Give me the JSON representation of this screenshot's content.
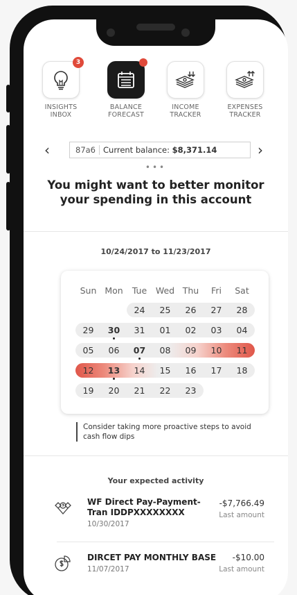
{
  "tabs": [
    {
      "label_line1": "INSIGHTS",
      "label_line2": "INBOX",
      "badge": "3",
      "icon": "lightbulb-icon",
      "active": false
    },
    {
      "label_line1": "BALANCE",
      "label_line2": "FORECAST",
      "badge": "",
      "icon": "calendar-icon",
      "active": true
    },
    {
      "label_line1": "INCOME",
      "label_line2": "TRACKER",
      "badge": "",
      "icon": "money-in-icon",
      "active": false
    },
    {
      "label_line1": "EXPENSES",
      "label_line2": "TRACKER",
      "badge": "",
      "icon": "money-out-icon",
      "active": false
    }
  ],
  "balance": {
    "account": "87a6",
    "label": "Current balance:",
    "amount": "$8,371.14",
    "prev_arrow": "‹",
    "next_arrow": "›"
  },
  "pager_dots": "•••",
  "headline": "You might want to better monitor your spending in this account",
  "date_range": "10/24/2017 to 11/23/2017",
  "calendar": {
    "weekdays": [
      "Sun",
      "Mon",
      "Tue",
      "Wed",
      "Thu",
      "Fri",
      "Sat"
    ],
    "weeks": [
      [
        "",
        "",
        "24",
        "25",
        "26",
        "27",
        "28"
      ],
      [
        "29",
        "30",
        "31",
        "01",
        "02",
        "03",
        "04"
      ],
      [
        "05",
        "06",
        "07",
        "08",
        "09",
        "10",
        "11"
      ],
      [
        "12",
        "13",
        "14",
        "15",
        "16",
        "17",
        "18"
      ],
      [
        "19",
        "20",
        "21",
        "22",
        "23",
        "",
        ""
      ]
    ]
  },
  "tip": "Consider taking more proactive steps to avoid cash flow dips",
  "activity_title": "Your expected activity",
  "transactions": [
    {
      "name": "WF Direct Pay-Payment-Tran IDDPXXXXXXXX",
      "date": "10/30/2017",
      "amount": "-$7,766.49",
      "sub": "Last amount",
      "icon": "handshake-icon"
    },
    {
      "name": "DIRCET PAY MONTHLY BASE",
      "date": "11/07/2017",
      "amount": "-$10.00",
      "sub": "Last amount",
      "icon": "dollar-chart-icon"
    }
  ],
  "colors": {
    "accent": "#e04a3a",
    "highlight": "#f08a7a"
  }
}
